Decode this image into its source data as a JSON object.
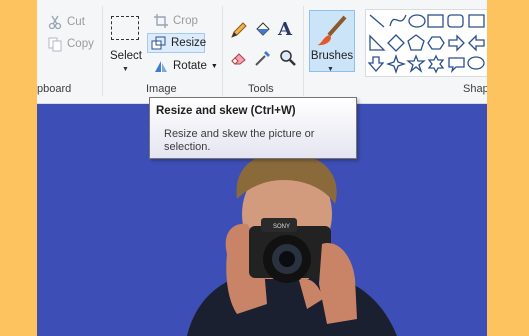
{
  "clipboard": {
    "cut_label": "Cut",
    "copy_label": "Copy",
    "group_label": "pboard"
  },
  "image": {
    "select_label": "Select",
    "crop_label": "Crop",
    "resize_label": "Resize",
    "rotate_label": "Rotate",
    "group_label": "Image"
  },
  "tools": {
    "group_label": "Tools",
    "text_tool_glyph": "A"
  },
  "brushes": {
    "label": "Brushes"
  },
  "shapes": {
    "group_label": "Shap"
  },
  "tooltip": {
    "title": "Resize and skew (Ctrl+W)",
    "description": "Resize and skew the picture or selection."
  },
  "photo": {
    "camera_brand": "SONY"
  },
  "colors": {
    "background": "#fdc35f",
    "canvas": "#3d4fb6",
    "ribbon": "#f5f6f7",
    "accent": "#cce4f7"
  }
}
